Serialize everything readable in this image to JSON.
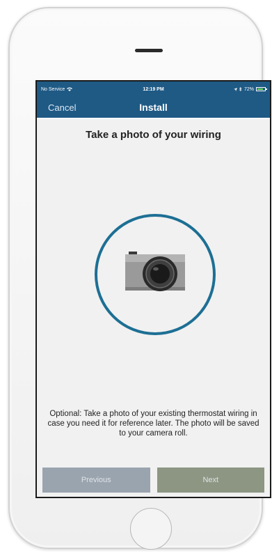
{
  "status_bar": {
    "carrier": "No Service",
    "time": "12:19 PM",
    "battery": "72%"
  },
  "nav": {
    "cancel_label": "Cancel",
    "title": "Install"
  },
  "content": {
    "heading": "Take a photo of your wiring",
    "icon": "camera-icon",
    "description": "Optional: Take a photo of your existing thermostat wiring in case you need it for reference later. The photo will be saved to your camera roll."
  },
  "buttons": {
    "previous_label": "Previous",
    "next_label": "Next"
  },
  "colors": {
    "header_blue": "#1f5a85",
    "ring_blue": "#1d6f94",
    "previous_button": "#9aa4af",
    "next_button": "#8c9683"
  }
}
